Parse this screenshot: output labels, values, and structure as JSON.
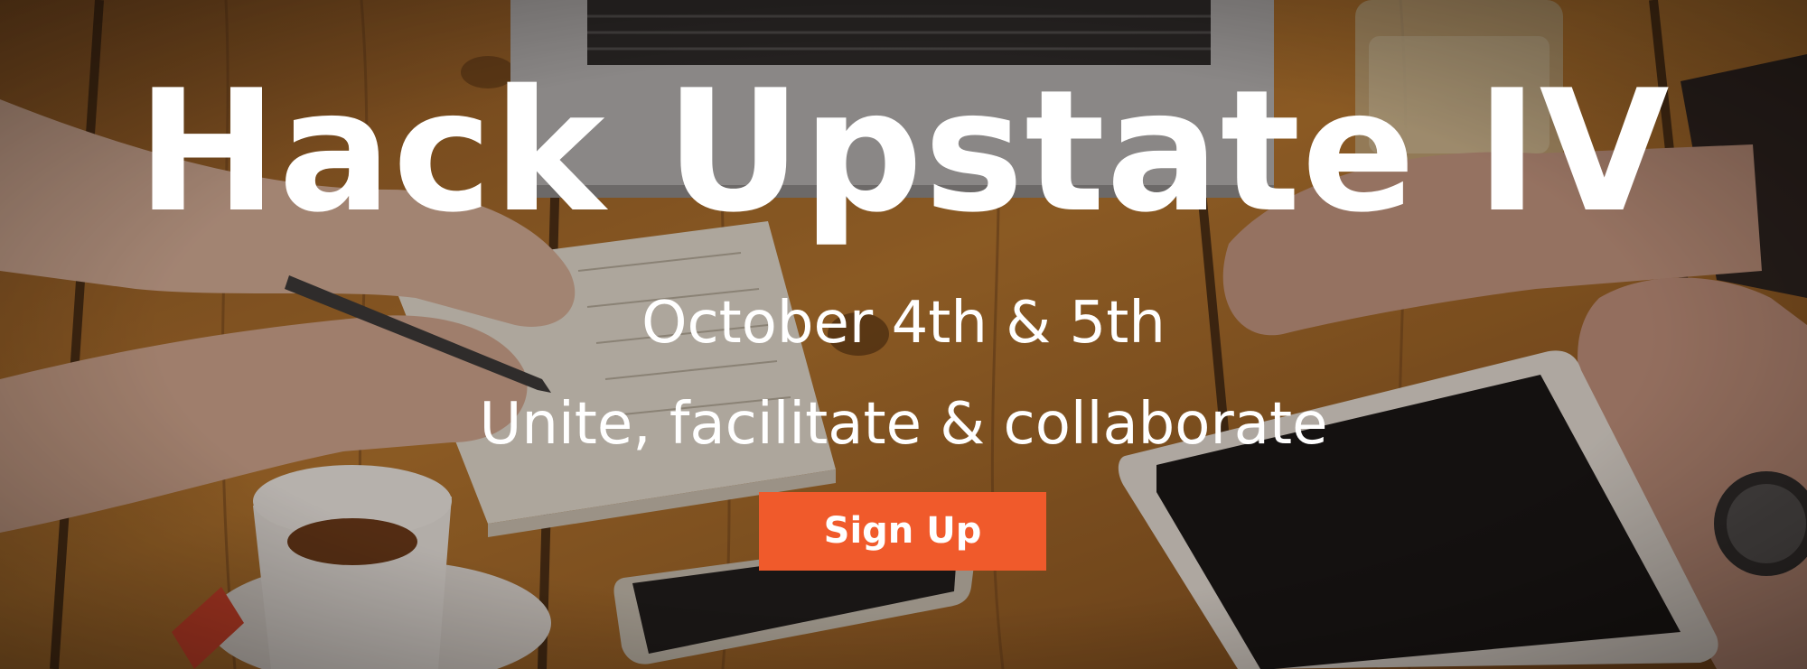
{
  "hero": {
    "title": "Hack Upstate IV",
    "date": "October 4th & 5th",
    "tagline": "Unite, facilitate & collaborate",
    "signup_label": "Sign Up"
  },
  "colors": {
    "button": "#f05a2b",
    "text": "#ffffff",
    "wood": "#b77a33"
  }
}
